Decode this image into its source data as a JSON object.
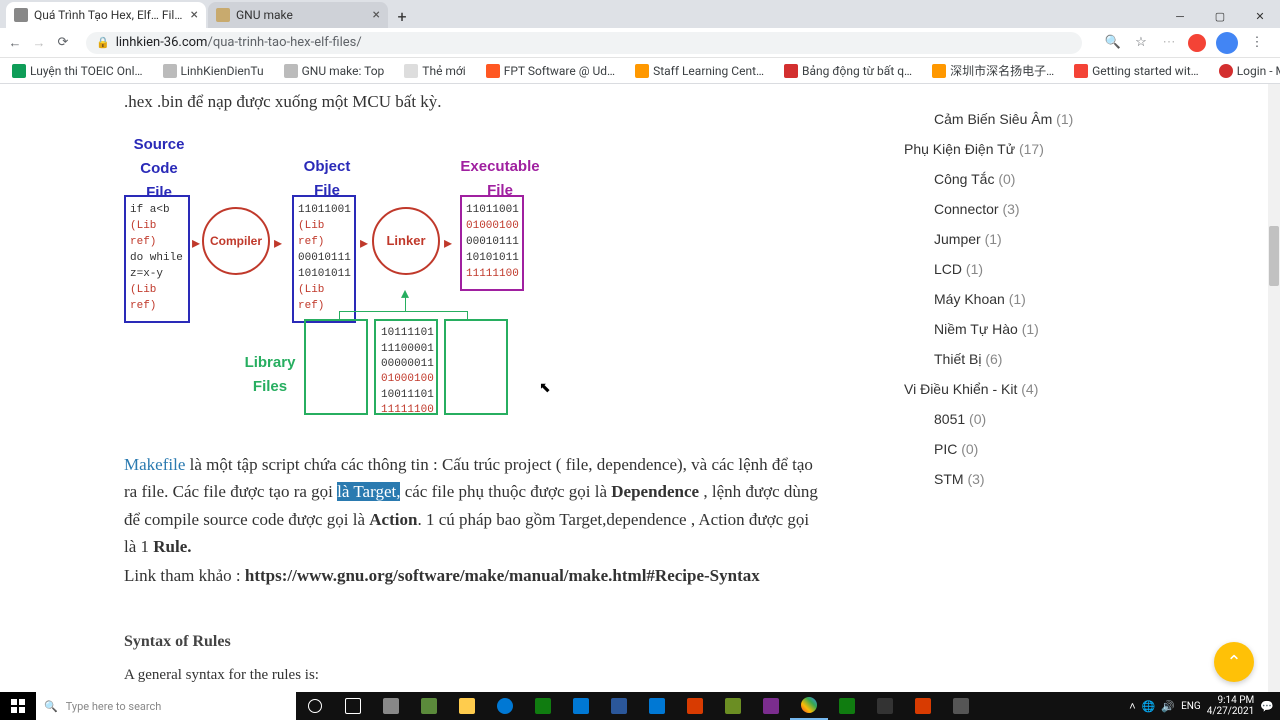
{
  "tabs": [
    {
      "title": "Quá Trình Tạo Hex, Elf… Files Phầ"
    },
    {
      "title": "GNU make"
    }
  ],
  "url": {
    "domain": "linhkien-36.com",
    "path": "/qua-trinh-tao-hex-elf-files/"
  },
  "bookmarks": [
    {
      "label": "Luyện thi TOEIC Onl…",
      "color": "#0f9d58"
    },
    {
      "label": "LinhKienDienTu",
      "color": "#888"
    },
    {
      "label": "GNU make: Top",
      "color": "#888"
    },
    {
      "label": "Thẻ mới",
      "color": "#888"
    },
    {
      "label": "FPT Software @ Ud…",
      "color": "#ff5722"
    },
    {
      "label": "Staff Learning Cent…",
      "color": "#ff9800"
    },
    {
      "label": "Bảng động từ bất q…",
      "color": "#d32f2f"
    },
    {
      "label": "深圳市深名扬电子…",
      "color": "#ff9800"
    },
    {
      "label": "Getting started wit…",
      "color": "#f44336"
    },
    {
      "label": "Login - MEGA",
      "color": "#d32f2f"
    }
  ],
  "article": {
    "intro": ".hex .bin để nạp được xuống một MCU bất kỳ.",
    "diagram": {
      "srcLabel": "Source\nCode\nFile",
      "objLabel": "Object\nFile",
      "exeLabel": "Executable\nFile",
      "libLabel": "Library\nFiles",
      "compiler": "Compiler",
      "linker": "Linker",
      "srcBox": [
        "if a<b",
        "(Lib ref)",
        "do while",
        "z=x-y",
        "(Lib ref)"
      ],
      "objBox": [
        "11011001",
        "(Lib ref)",
        "00010111",
        "10101011",
        "(Lib ref)"
      ],
      "exeBox": [
        "11011001",
        "01000100",
        "00010111",
        "10101011",
        "11111100"
      ],
      "libBox": [
        "10111101",
        "11100001",
        "00000011",
        "01000100",
        "10011101",
        "11111100"
      ]
    },
    "text1_a": "Makefile",
    "text1_b": " là một tập script chứa các thông tin : Cấu trúc project ( file, dependence), và các lệnh để tạo ra file. Các file được tạo ra gọi ",
    "text1_hl": "là Target,",
    "text1_c": " các file phụ thuộc được gọi là ",
    "text1_d": "Dependence",
    "text1_e": " , lệnh được dùng để compile source code được gọi là ",
    "text1_f": "Action",
    "text1_g": ". 1  cú pháp bao gồm Target,dependence , Action được gọi là 1 ",
    "text1_h": "Rule.",
    "link_pre": "Link tham khảo : ",
    "link_url": "https://www.gnu.org/software/make/manual/make.html#Recipe-Syntax",
    "syntax_h": "Syntax of Rules",
    "syntax_p": "A general syntax for the rules is:"
  },
  "sidebar": {
    "c0": {
      "label": "Cảm Biến Siêu Âm",
      "count": "(1)"
    },
    "g1": {
      "label": "Phụ Kiện Điện Tử",
      "count": "(17)"
    },
    "s1": [
      {
        "label": "Công Tắc",
        "count": "(0)"
      },
      {
        "label": "Connector",
        "count": "(3)"
      },
      {
        "label": "Jumper",
        "count": "(1)"
      },
      {
        "label": "LCD",
        "count": "(1)"
      },
      {
        "label": "Máy Khoan",
        "count": "(1)"
      },
      {
        "label": "Niềm Tự Hào",
        "count": "(1)"
      },
      {
        "label": "Thiết Bị",
        "count": "(6)"
      }
    ],
    "g2": {
      "label": "Vi Điều Khiển - Kit",
      "count": "(4)"
    },
    "s2": [
      {
        "label": "8051",
        "count": "(0)"
      },
      {
        "label": "PIC",
        "count": "(0)"
      },
      {
        "label": "STM",
        "count": "(3)"
      }
    ]
  },
  "search": {
    "placeholder": "Type here to search"
  },
  "clock": {
    "time": "9:14 PM",
    "date": "4/27/2021"
  }
}
